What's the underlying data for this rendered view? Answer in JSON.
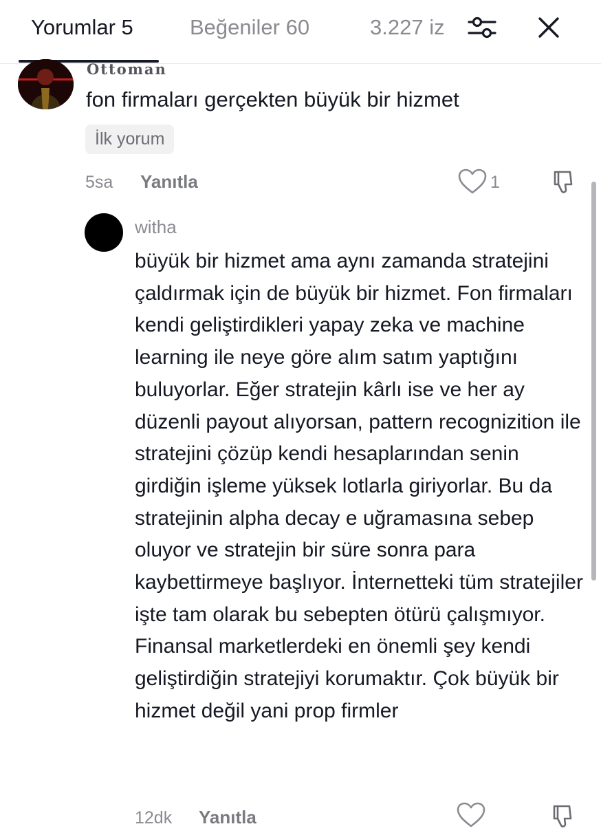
{
  "tabs": [
    {
      "label": "Yorumlar 5",
      "active": true
    },
    {
      "label": "Beğeniler 60",
      "active": false
    },
    {
      "label": "3.227 iz",
      "active": false
    }
  ],
  "header_icons": {
    "filter": "sliders-icon",
    "close": "close-icon"
  },
  "comments": [
    {
      "username": "Ottoman",
      "text": "fon firmaları gerçekten büyük bir hizmet",
      "badge": "İlk yorum",
      "time": "5sa",
      "reply_label": "Yanıtla",
      "likes": "1"
    }
  ],
  "reply": {
    "username": "witha",
    "text": "büyük bir hizmet ama aynı zamanda stratejini çaldırmak için de büyük bir hizmet. Fon firmaları kendi geliştirdikleri yapay zeka ve machine learning ile neye göre alım satım yaptığını buluyorlar. Eğer stratejin kârlı ise ve her ay düzenli payout alıyorsan, pattern recognizition ile stratejini çözüp kendi hesaplarından senin girdiğin işleme yüksek lotlarla giriyorlar. Bu da stratejinin alpha decay e uğramasına sebep oluyor ve stratejin bir süre sonra para kaybettirmeye başlıyor. İnternetteki tüm stratejiler işte tam olarak bu sebepten ötürü çalışmıyor. Finansal marketlerdeki en önemli şey kendi geliştirdiğin stratejiyi korumaktır. Çok büyük bir hizmet değil yani prop firmler",
    "time": "12dk",
    "reply_label": "Yanıtla"
  },
  "colors": {
    "text": "#161823",
    "muted": "#8a8b91",
    "accent_underline": "#161823"
  }
}
